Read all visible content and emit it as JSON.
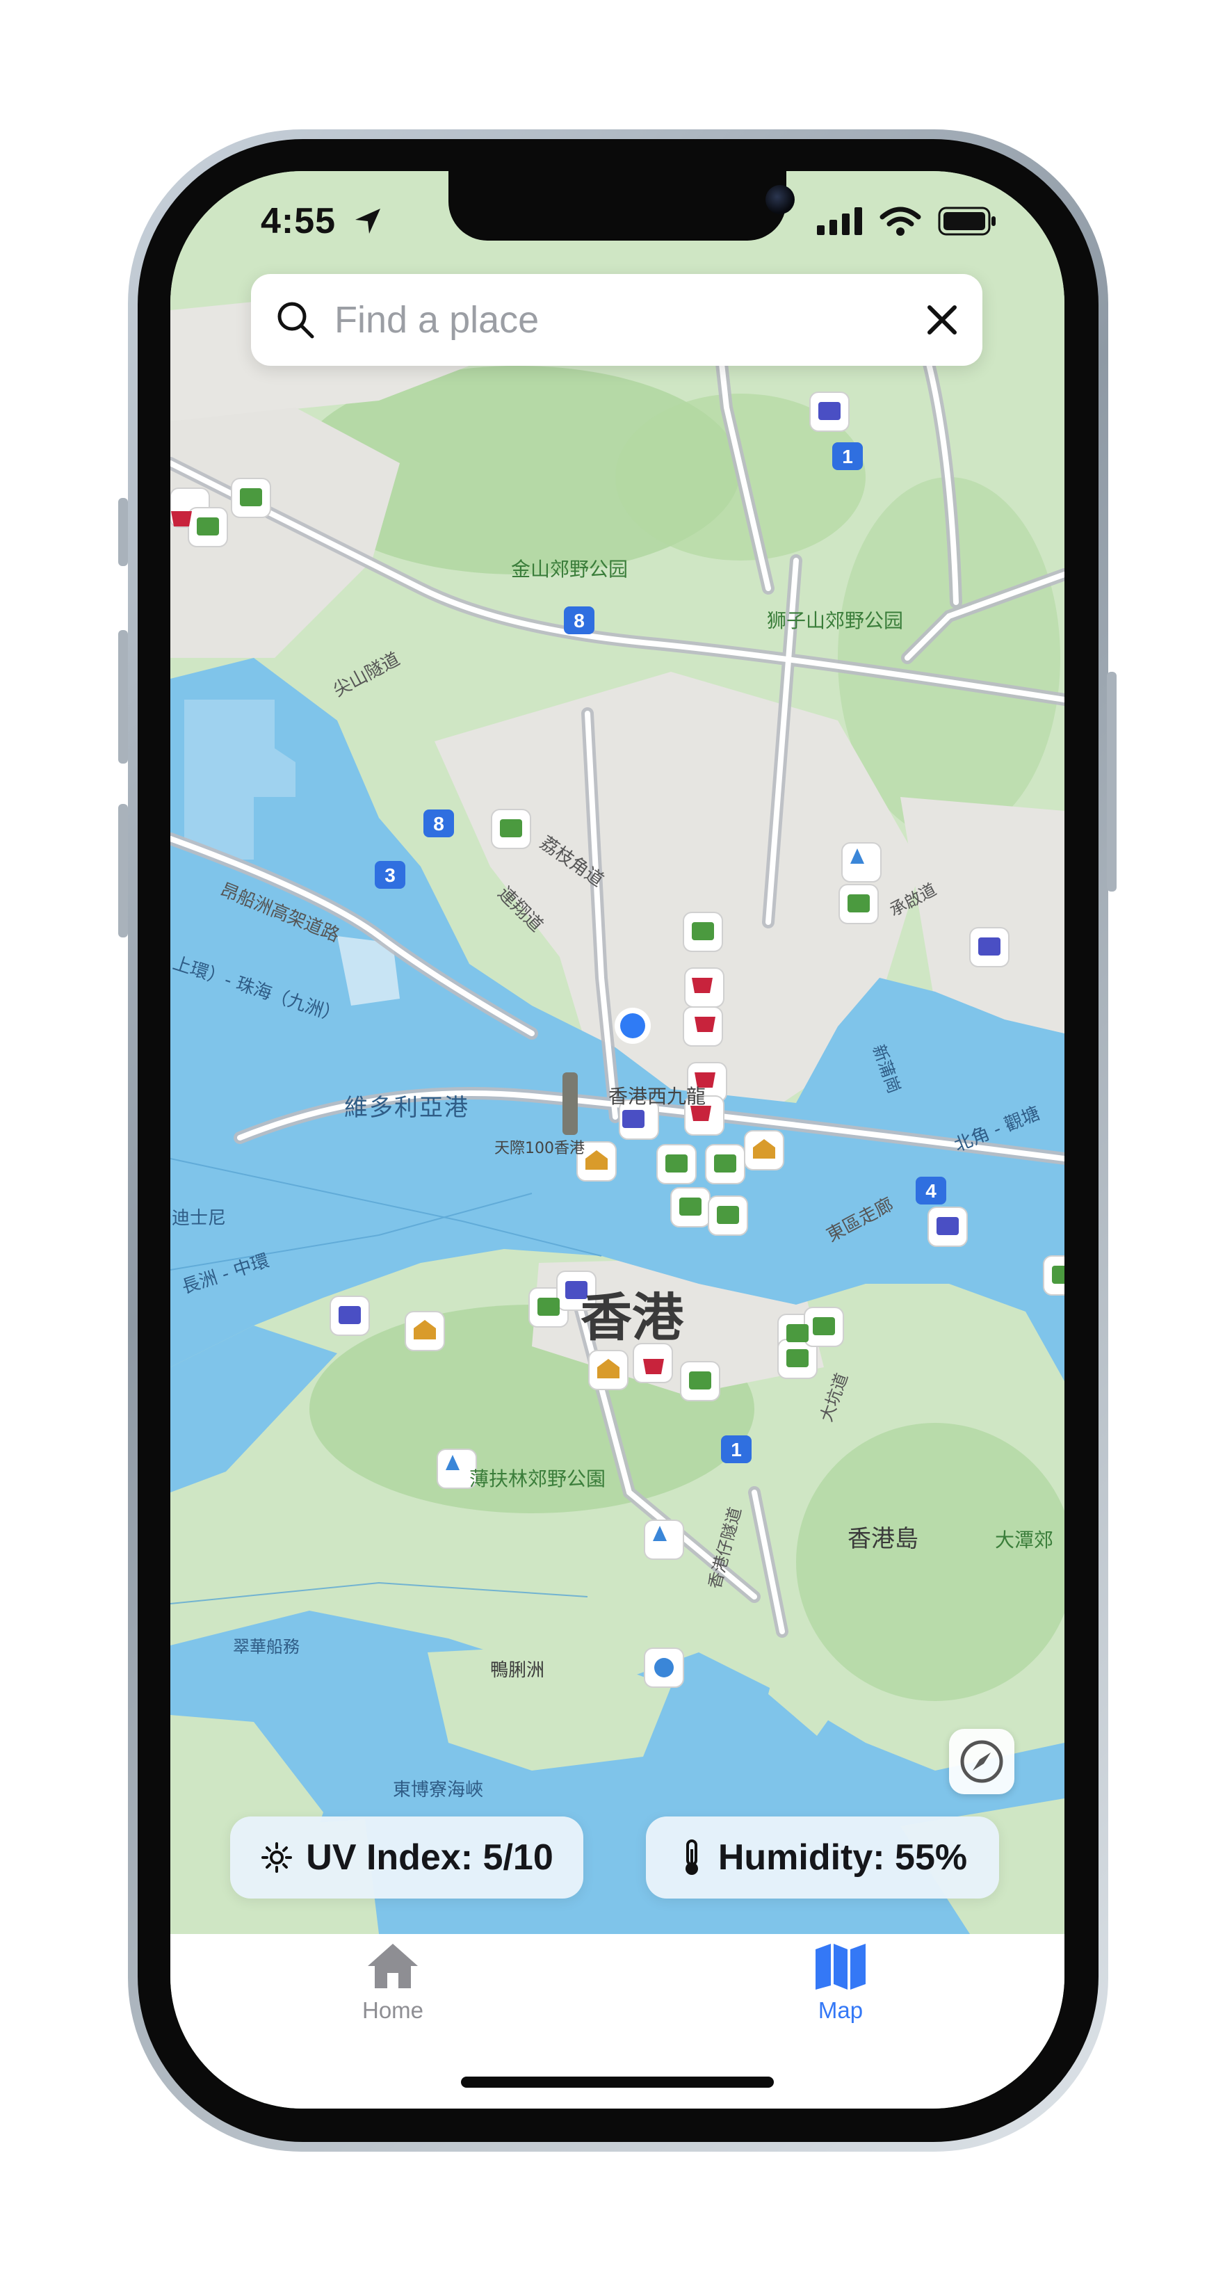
{
  "status_bar": {
    "time": "4:55"
  },
  "search": {
    "placeholder": "Find a place"
  },
  "map_labels": {
    "kam_shan": "金山郊野公园",
    "lion_rock": "狮子山郊野公园",
    "tsim_tunnel": "尖山隧道",
    "lai_chi_kok": "荔枝角道",
    "lin_cheung": "連翔道",
    "ngong_shun": "昂船洲高架道路",
    "route_ring": "上環）- 珠海（九洲）",
    "victoria_harbour": "維多利亞港",
    "west_kowloon": "香港西九龍",
    "sky100": "天際100香港",
    "disney": "迪士尼",
    "cheung_chau": "長洲 - 中環",
    "hong_kong": "香港",
    "pok_fu_lam": "薄扶林郊野公園",
    "hk_island": "香港島",
    "tai_tam": "大潭郊",
    "aberdeen_tunnel": "香港仔隧道",
    "tai_hang": "大坑道",
    "eastern_corridor": "東區走廊",
    "north_point": "北角 - 觀塘",
    "kai_tak": "新蒲崗",
    "shing_road": "承啟道",
    "ap_lei_chau": "鴨脷洲",
    "shipping": "翠華船務",
    "east_lamma": "東博寮海峽",
    "route_1": "1",
    "route_3": "3",
    "route_4": "4",
    "route_8": "8"
  },
  "weather": {
    "uv_label": "UV Index: 5/10",
    "humidity_label": "Humidity: 55%"
  },
  "tabs": [
    {
      "label": "Home",
      "active": false,
      "icon": "house-icon"
    },
    {
      "label": "Map",
      "active": true,
      "icon": "map-icon"
    }
  ],
  "colors": {
    "accent": "#3478f6",
    "inactive_tab": "#8e8e93",
    "water": "#7fc4ea",
    "land": "#cfe6c4",
    "route_shield": "#2f6fe0"
  }
}
